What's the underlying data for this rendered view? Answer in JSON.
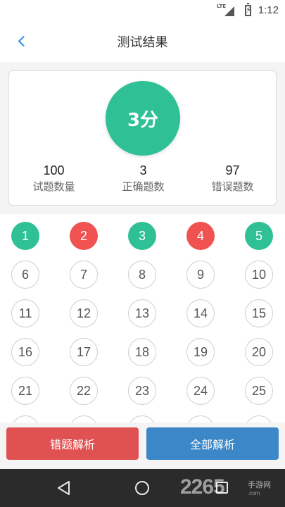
{
  "status_bar": {
    "network": "LTE",
    "time": "1:12"
  },
  "header": {
    "title": "测试结果"
  },
  "result": {
    "score": "3分",
    "stats": [
      {
        "value": "100",
        "label": "试题数量"
      },
      {
        "value": "3",
        "label": "正确题数"
      },
      {
        "value": "97",
        "label": "错误题数"
      }
    ]
  },
  "questions": [
    {
      "num": "1",
      "state": "correct"
    },
    {
      "num": "2",
      "state": "wrong"
    },
    {
      "num": "3",
      "state": "correct"
    },
    {
      "num": "4",
      "state": "wrong"
    },
    {
      "num": "5",
      "state": "correct"
    },
    {
      "num": "6",
      "state": "unanswered"
    },
    {
      "num": "7",
      "state": "unanswered"
    },
    {
      "num": "8",
      "state": "unanswered"
    },
    {
      "num": "9",
      "state": "unanswered"
    },
    {
      "num": "10",
      "state": "unanswered"
    },
    {
      "num": "11",
      "state": "unanswered"
    },
    {
      "num": "12",
      "state": "unanswered"
    },
    {
      "num": "13",
      "state": "unanswered"
    },
    {
      "num": "14",
      "state": "unanswered"
    },
    {
      "num": "15",
      "state": "unanswered"
    },
    {
      "num": "16",
      "state": "unanswered"
    },
    {
      "num": "17",
      "state": "unanswered"
    },
    {
      "num": "18",
      "state": "unanswered"
    },
    {
      "num": "19",
      "state": "unanswered"
    },
    {
      "num": "20",
      "state": "unanswered"
    },
    {
      "num": "21",
      "state": "unanswered"
    },
    {
      "num": "22",
      "state": "unanswered"
    },
    {
      "num": "23",
      "state": "unanswered"
    },
    {
      "num": "24",
      "state": "unanswered"
    },
    {
      "num": "25",
      "state": "unanswered"
    }
  ],
  "actions": {
    "wrong_analysis": "错题解析",
    "all_analysis": "全部解析"
  },
  "colors": {
    "correct": "#2fc095",
    "wrong": "#f05252",
    "accent_blue": "#3b87c8",
    "back_arrow": "#2d8ee0"
  },
  "watermark": {
    "brand": "2265",
    "sub": "手游网",
    "url": ".com"
  }
}
